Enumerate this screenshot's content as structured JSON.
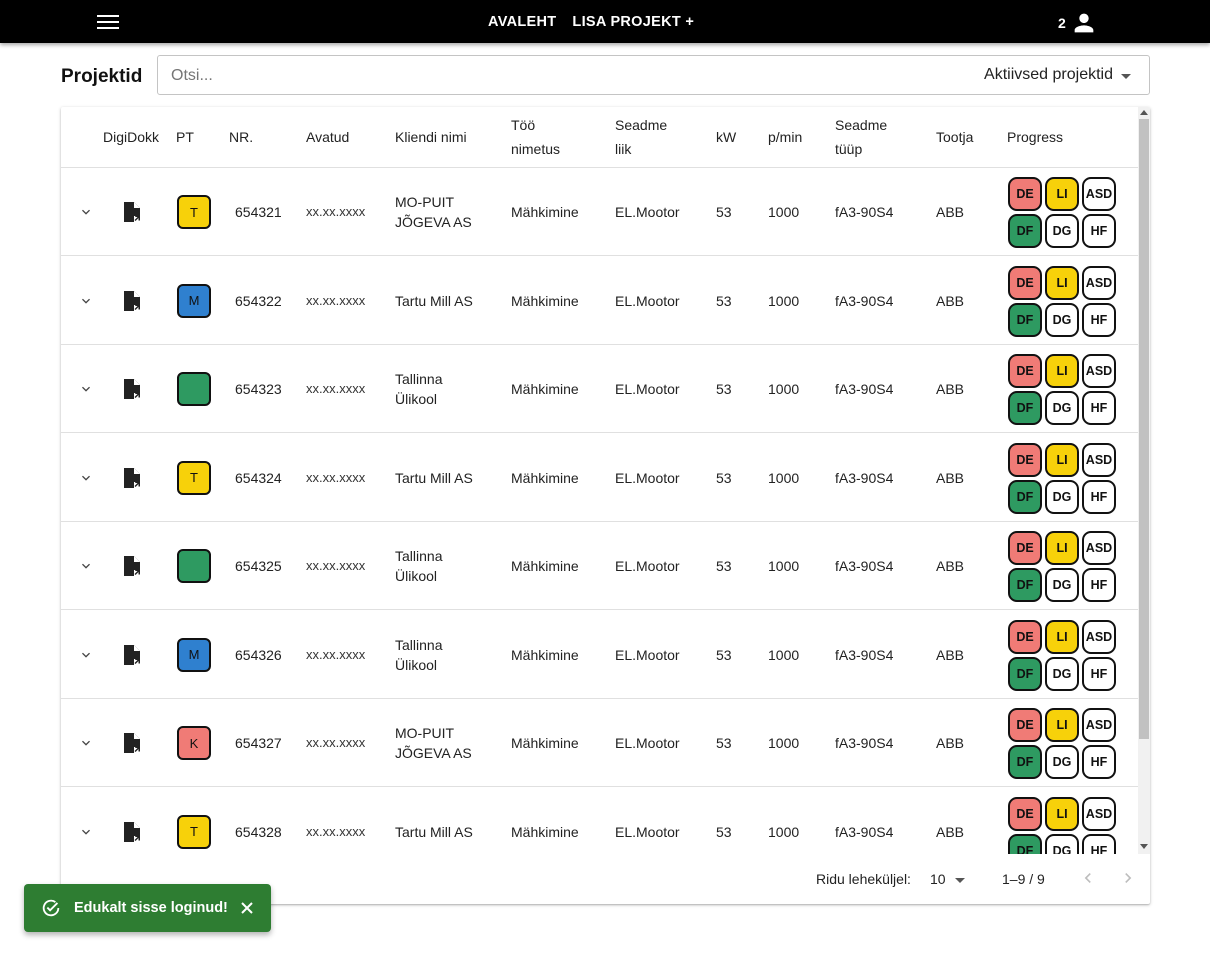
{
  "nav": {
    "home": "AVALEHT",
    "add_project": "LISA PROJEKT +",
    "user_count": "2"
  },
  "page": {
    "title": "Projektid"
  },
  "search": {
    "placeholder": "Otsi...",
    "value": "",
    "filter_label": "Aktiivsed projektid"
  },
  "columns": {
    "digidokk": "DigiDokk",
    "pt": "PT",
    "nr": "NR.",
    "avatud": "Avatud",
    "klient": "Kliendi nimi",
    "too_1": "Töö",
    "too_2": "nimetus",
    "seade_1": "Seadme",
    "seade_2": "liik",
    "kw": "kW",
    "pmin": "p/min",
    "tyyp_1": "Seadme",
    "tyyp_2": "tüüp",
    "tootja": "Tootja",
    "progress": "Progress"
  },
  "rows": [
    {
      "pt": "T",
      "pt_color": "#f7d10a",
      "nr": "654321",
      "avatud": "xx.xx.xxxx",
      "klient_1": "MO-PUIT",
      "klient_2": "JÕGEVA AS",
      "too": "Mähkimine",
      "seade": "EL.Mootor",
      "kw": "53",
      "pmin": "1000",
      "tyyp": "fA3-90S4",
      "tootja": "ABB"
    },
    {
      "pt": "M",
      "pt_color": "#2f80cf",
      "nr": "654322",
      "avatud": "xx.xx.xxxx",
      "klient_1": "Tartu Mill AS",
      "klient_2": "",
      "too": "Mähkimine",
      "seade": "EL.Mootor",
      "kw": "53",
      "pmin": "1000",
      "tyyp": "fA3-90S4",
      "tootja": "ABB"
    },
    {
      "pt": "",
      "pt_color": "#2e9a61",
      "nr": "654323",
      "avatud": "xx.xx.xxxx",
      "klient_1": "Tallinna",
      "klient_2": "Ülikool",
      "too": "Mähkimine",
      "seade": "EL.Mootor",
      "kw": "53",
      "pmin": "1000",
      "tyyp": "fA3-90S4",
      "tootja": "ABB"
    },
    {
      "pt": "T",
      "pt_color": "#f7d10a",
      "nr": "654324",
      "avatud": "xx.xx.xxxx",
      "klient_1": "Tartu Mill AS",
      "klient_2": "",
      "too": "Mähkimine",
      "seade": "EL.Mootor",
      "kw": "53",
      "pmin": "1000",
      "tyyp": "fA3-90S4",
      "tootja": "ABB"
    },
    {
      "pt": "",
      "pt_color": "#2e9a61",
      "nr": "654325",
      "avatud": "xx.xx.xxxx",
      "klient_1": "Tallinna",
      "klient_2": "Ülikool",
      "too": "Mähkimine",
      "seade": "EL.Mootor",
      "kw": "53",
      "pmin": "1000",
      "tyyp": "fA3-90S4",
      "tootja": "ABB"
    },
    {
      "pt": "M",
      "pt_color": "#2f80cf",
      "nr": "654326",
      "avatud": "xx.xx.xxxx",
      "klient_1": "Tallinna",
      "klient_2": "Ülikool",
      "too": "Mähkimine",
      "seade": "EL.Mootor",
      "kw": "53",
      "pmin": "1000",
      "tyyp": "fA3-90S4",
      "tootja": "ABB"
    },
    {
      "pt": "K",
      "pt_color": "#f07b76",
      "nr": "654327",
      "avatud": "xx.xx.xxxx",
      "klient_1": "MO-PUIT",
      "klient_2": "JÕGEVA AS",
      "too": "Mähkimine",
      "seade": "EL.Mootor",
      "kw": "53",
      "pmin": "1000",
      "tyyp": "fA3-90S4",
      "tootja": "ABB"
    },
    {
      "pt": "T",
      "pt_color": "#f7d10a",
      "nr": "654328",
      "avatud": "xx.xx.xxxx",
      "klient_1": "Tartu Mill AS",
      "klient_2": "",
      "too": "Mähkimine",
      "seade": "EL.Mootor",
      "kw": "53",
      "pmin": "1000",
      "tyyp": "fA3-90S4",
      "tootja": "ABB"
    }
  ],
  "progress": [
    {
      "label": "DE",
      "color": "#f07b76"
    },
    {
      "label": "LI",
      "color": "#f7d10a"
    },
    {
      "label": "ASD",
      "color": "#ffffff"
    },
    {
      "label": "DF",
      "color": "#2e9a61"
    },
    {
      "label": "DG",
      "color": "#ffffff"
    },
    {
      "label": "HF",
      "color": "#ffffff"
    }
  ],
  "pagination": {
    "rows_label": "Ridu leheküljel:",
    "rows_per_page": "10",
    "range": "1–9 / 9"
  },
  "toast": {
    "message": "Edukalt sisse loginud!",
    "color": "#2e7d32"
  }
}
